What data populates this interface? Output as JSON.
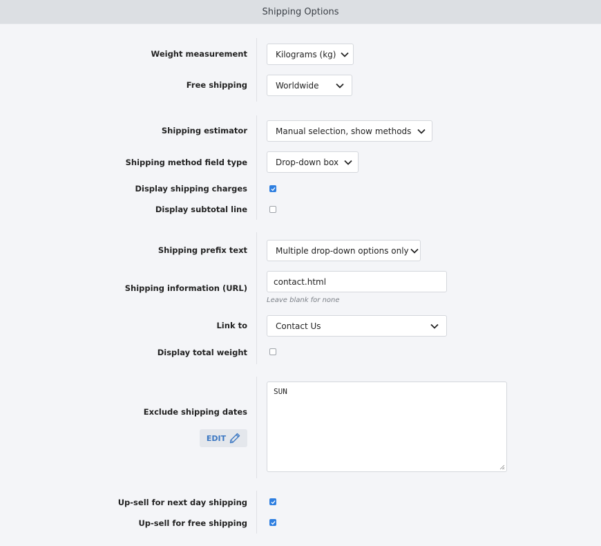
{
  "header": {
    "title": "Shipping Options"
  },
  "fields": {
    "weight_measurement": {
      "label": "Weight measurement",
      "value": "Kilograms (kg)"
    },
    "free_shipping": {
      "label": "Free shipping",
      "value": "Worldwide"
    },
    "shipping_estimator": {
      "label": "Shipping estimator",
      "value": "Manual selection, show methods"
    },
    "shipping_method_field_type": {
      "label": "Shipping method field type",
      "value": "Drop-down box"
    },
    "display_shipping_charges": {
      "label": "Display shipping charges",
      "checked": true
    },
    "display_subtotal_line": {
      "label": "Display subtotal line",
      "checked": false
    },
    "shipping_prefix_text": {
      "label": "Shipping prefix text",
      "value": "Multiple drop-down options only"
    },
    "shipping_information_url": {
      "label": "Shipping information (URL)",
      "value": "contact.html",
      "hint": "Leave blank for none"
    },
    "link_to": {
      "label": "Link to",
      "value": "Contact Us"
    },
    "display_total_weight": {
      "label": "Display total weight",
      "checked": false
    },
    "exclude_shipping_dates": {
      "label": "Exclude shipping dates",
      "value": "SUN",
      "edit_label": "EDIT"
    },
    "upsell_next_day": {
      "label": "Up-sell for next day shipping",
      "checked": true
    },
    "upsell_free_shipping": {
      "label": "Up-sell for free shipping",
      "checked": true
    }
  },
  "colors": {
    "accent": "#2f7fe0",
    "edit_text": "#3b77c2",
    "header_bg": "#dcdfe3",
    "page_bg": "#f4f5f8"
  }
}
